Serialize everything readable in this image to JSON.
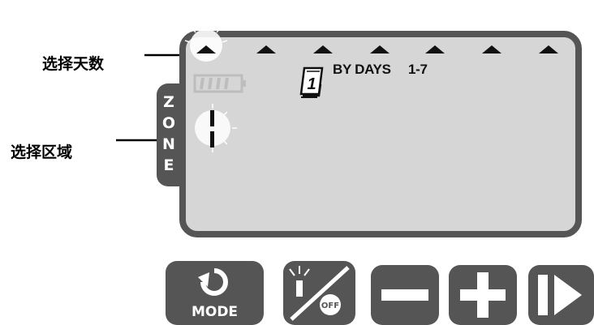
{
  "annotations": {
    "select_days": "选择天数",
    "select_zone": "选择区域"
  },
  "display": {
    "program_icon": "calendar-day-icon",
    "program_icon_digit": "1",
    "mode_text": "BY DAYS",
    "day_range": "1-7",
    "day_marker_count": 7,
    "selected_day_marker": 1
  },
  "zone_tab": {
    "letters": [
      "Z",
      "O",
      "N",
      "E"
    ]
  },
  "buttons": {
    "mode": {
      "label": "MODE",
      "icon": "rotate-arrow-icon"
    },
    "off": {
      "label": "OFF",
      "icon": "sprinkler-off-icon"
    },
    "minus": {
      "icon": "minus-icon"
    },
    "plus": {
      "icon": "plus-icon"
    },
    "next": {
      "icon": "next-arrow-icon"
    }
  },
  "colors": {
    "panel_border": "#555555",
    "lcd_background": "#d6d6d6",
    "button": "#555555"
  }
}
